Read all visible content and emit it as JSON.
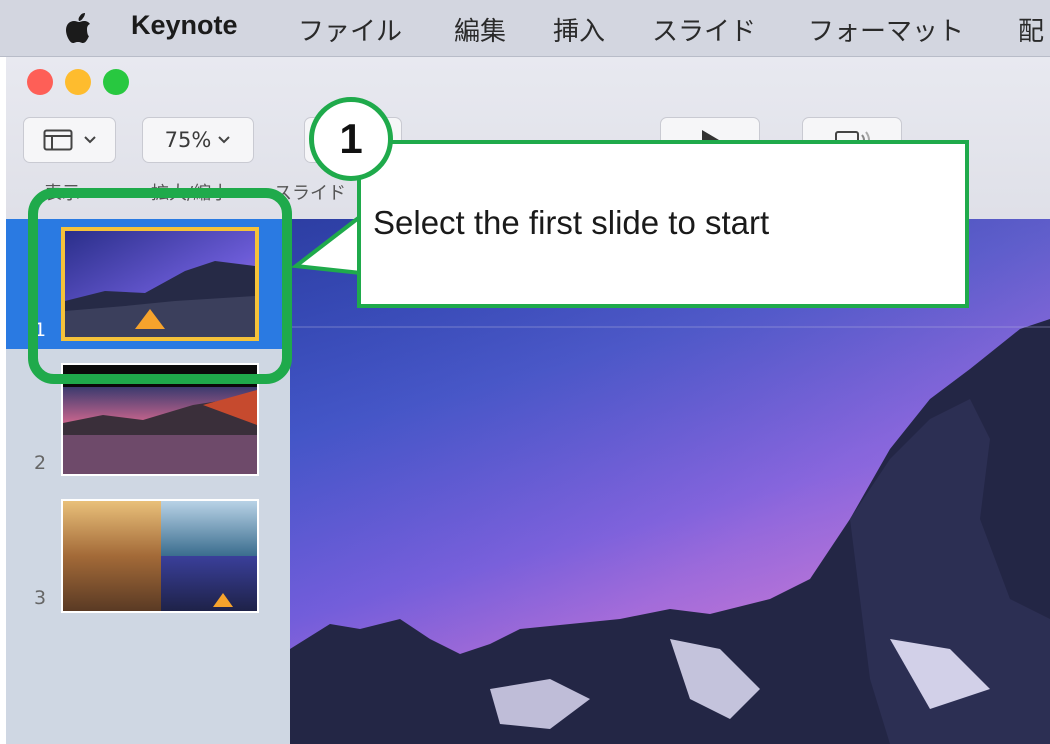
{
  "menubar": {
    "app_name": "Keynote",
    "items": [
      "ファイル",
      "編集",
      "挿入",
      "スライド",
      "フォーマット",
      "配"
    ]
  },
  "toolbar": {
    "view_label": "表示",
    "zoom_value": "75%",
    "zoom_label": "拡大/縮小",
    "slide_label": "スライド"
  },
  "slides": [
    {
      "number": "1",
      "selected": true
    },
    {
      "number": "2",
      "selected": false
    },
    {
      "number": "3",
      "selected": false
    }
  ],
  "callout": {
    "step": "1",
    "text": "Select the first slide to start"
  },
  "colors": {
    "highlight_green": "#1faa4b",
    "selection_blue": "#2a7ae2",
    "selected_border": "#f5c23a"
  }
}
